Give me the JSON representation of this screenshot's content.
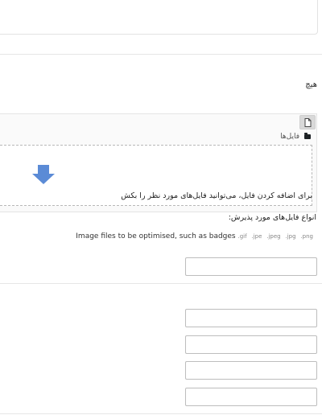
{
  "fields": {
    "none_text": "هیچ"
  },
  "filemanager": {
    "path_label": "فایل‌ها",
    "dropzone_text": "برای اضافه کردن فایل، می‌توانید فایل‌های مورد نظر را بکش",
    "accepted_label": "انواع فایل‌های مورد پذیرش:",
    "accepted_types": [
      ".gif",
      ".jpe",
      ".jpeg",
      ".jpg",
      ".png"
    ],
    "accepted_desc": "Image files to be optimised, such as badges",
    "arrow_color": "#5b8bd6"
  },
  "inputs": [
    {
      "value": ""
    },
    {
      "value": ""
    },
    {
      "value": ""
    },
    {
      "value": ""
    },
    {
      "value": ""
    }
  ]
}
